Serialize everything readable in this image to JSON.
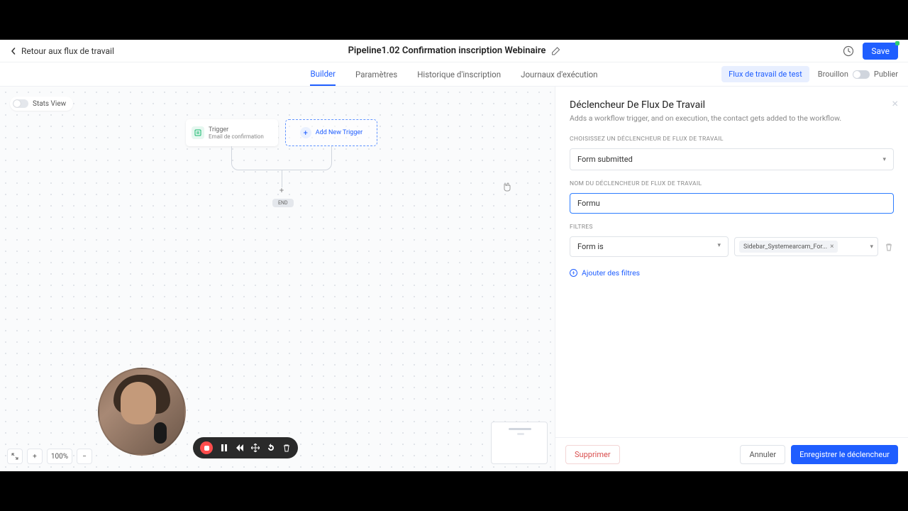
{
  "header": {
    "back": "Retour aux flux de travail",
    "title": "Pipeline1.02 Confirmation inscription Webinaire",
    "save": "Save"
  },
  "tabs": {
    "builder": "Builder",
    "params": "Paramètres",
    "history": "Historique d'inscription",
    "logs": "Journaux d'exécution",
    "test": "Flux de travail de test",
    "draft": "Brouillon",
    "publish": "Publier"
  },
  "canvas": {
    "stats": "Stats View",
    "trigger_label": "Trigger",
    "trigger_sub": "Email de confirmation",
    "add_trigger": "Add New Trigger",
    "end": "END",
    "zoom_pct": "100%"
  },
  "panel": {
    "title": "Déclencheur De Flux De Travail",
    "desc": "Adds a workflow trigger, and on execution, the contact gets added to the workflow.",
    "choose_label": "CHOISISSEZ UN DÉCLENCHEUR DE FLUX DE TRAVAIL",
    "trigger_value": "Form submitted",
    "name_label": "NOM DU DÉCLENCHEUR DE FLUX DE TRAVAIL",
    "name_value": "Formu",
    "filters_label": "FILTRES",
    "filter_field": "Form is",
    "filter_chip": "Sidebar_Systemearcam_For...",
    "add_filter": "Ajouter des filtres",
    "delete": "Supprimer",
    "cancel": "Annuler",
    "save": "Enregistrer le déclencheur"
  }
}
